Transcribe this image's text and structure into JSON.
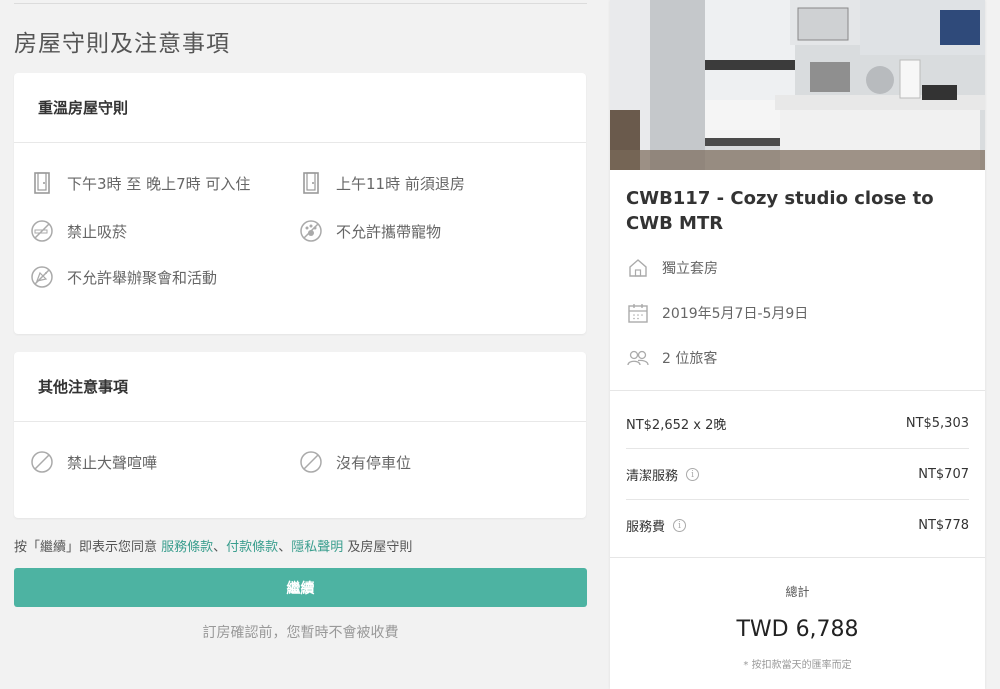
{
  "page": {
    "section_title": "房屋守則及注意事項"
  },
  "house_rules": {
    "heading": "重溫房屋守則",
    "items": [
      {
        "icon": "door-icon",
        "text": "下午3時 至 晚上7時 可入住"
      },
      {
        "icon": "door-icon",
        "text": "上午11時 前須退房"
      },
      {
        "icon": "no-smoking-icon",
        "text": "禁止吸菸"
      },
      {
        "icon": "no-pets-icon",
        "text": "不允許攜帶寵物"
      },
      {
        "icon": "no-parties-icon",
        "text": "不允許舉辦聚會和活動"
      }
    ]
  },
  "other_notes": {
    "heading": "其他注意事項",
    "items": [
      {
        "icon": "prohibited-icon",
        "text": "禁止大聲喧嘩"
      },
      {
        "icon": "prohibited-icon",
        "text": "沒有停車位"
      }
    ]
  },
  "consent": {
    "prefix": "按「繼續」即表示您同意 ",
    "terms_link": "服務條款",
    "sep1": "、",
    "payment_link": "付款條款",
    "sep2": "、",
    "privacy_link": "隱私聲明",
    "suffix": " 及房屋守則"
  },
  "actions": {
    "continue_label": "繼續"
  },
  "note": "訂房確認前，您暫時不會被收費",
  "listing": {
    "title": "CWB117 - Cozy studio close to CWB MTR",
    "room_type": "獨立套房",
    "dates": "2019年5月7日-5月9日",
    "guests": "2 位旅客"
  },
  "pricing": {
    "rows": [
      {
        "label": "NT$2,652 x 2晚",
        "amount": "NT$5,303",
        "info": false
      },
      {
        "label": "清潔服務",
        "amount": "NT$707",
        "info": true
      },
      {
        "label": "服務費",
        "amount": "NT$778",
        "info": true
      }
    ],
    "total_label": "總計",
    "total_value": "TWD 6,788",
    "total_note": "* 按扣款當天的匯率而定"
  },
  "colors": {
    "accent": "#4db3a2",
    "link": "#3a9e8e"
  }
}
